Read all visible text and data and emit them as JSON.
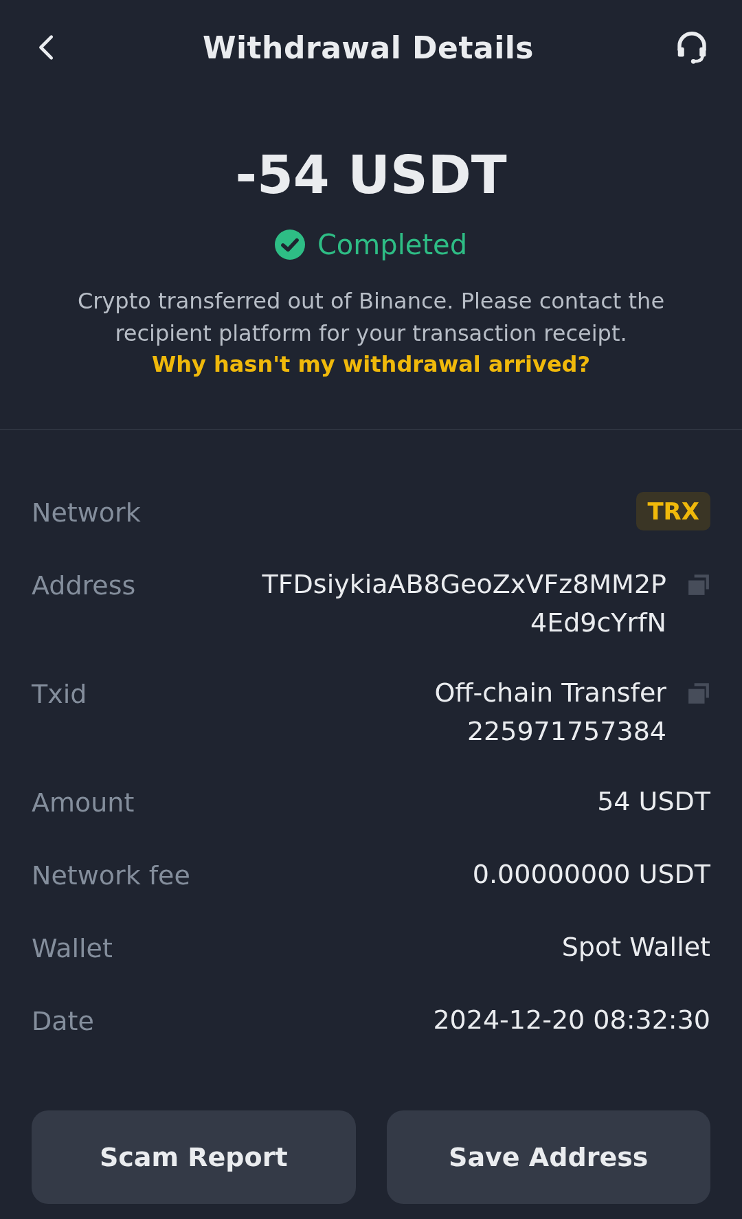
{
  "header": {
    "title": "Withdrawal Details"
  },
  "summary": {
    "amount": "-54 USDT",
    "status": "Completed",
    "success": true,
    "note": "Crypto transferred out of Binance. Please contact the recipient platform for your transaction receipt.",
    "help_link": "Why hasn't my withdrawal arrived?"
  },
  "details": [
    {
      "label": "Network",
      "kind": "tag",
      "lines": [
        "TRX"
      ]
    },
    {
      "label": "Address",
      "kind": "copy",
      "lines": [
        "TFDsiykiaAB8GeoZxVFz8MM2P",
        "4Ed9cYrfN"
      ]
    },
    {
      "label": "Txid",
      "kind": "copy",
      "lines": [
        "Off-chain Transfer",
        "225971757384"
      ]
    },
    {
      "label": "Amount",
      "kind": "text",
      "lines": [
        "54 USDT"
      ]
    },
    {
      "label": "Network fee",
      "kind": "text",
      "lines": [
        "0.00000000 USDT"
      ]
    },
    {
      "label": "Wallet",
      "kind": "text",
      "lines": [
        "Spot Wallet"
      ]
    },
    {
      "label": "Date",
      "kind": "text",
      "lines": [
        "2024-12-20 08:32:30"
      ]
    }
  ],
  "buttons": [
    "Scam Report",
    "Save Address"
  ]
}
